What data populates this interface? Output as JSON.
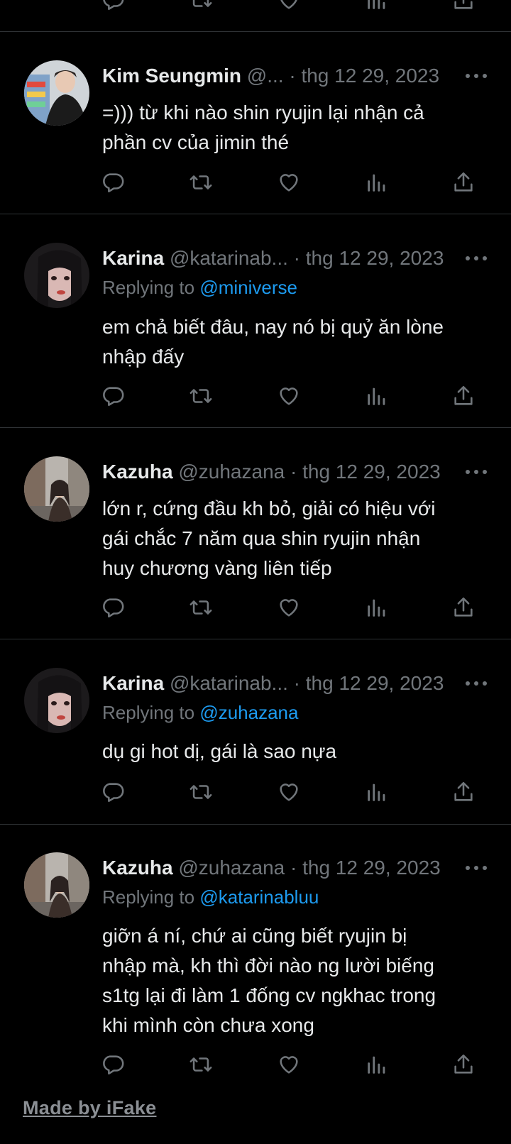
{
  "colors": {
    "background": "#000000",
    "text": "#e7e9ea",
    "muted": "#71767b",
    "link": "#1d9bf0",
    "divider": "#2f3336"
  },
  "icons": {
    "reply": "comment-bubble-icon",
    "retweet": "retweet-icon",
    "like": "heart-icon",
    "views": "bar-chart-icon",
    "share": "share-upload-icon",
    "more": "more-dots-icon"
  },
  "tweets": [
    {
      "name": "Kim Seungmin",
      "meta": "@... · thg 12 29, 2023",
      "replying_label": "",
      "replying_handle": "",
      "lines": [
        "=))) từ khi nào shin ryujin lại nhận cả",
        "phần cv của jimin thé"
      ]
    },
    {
      "name": "Karina",
      "meta": "@katarinab... · thg 12 29, 2023",
      "replying_label": "Replying to",
      "replying_handle": "@miniverse",
      "lines": [
        "em chả biết đâu, nay nó bị quỷ ăn lòne",
        "nhập đấy"
      ]
    },
    {
      "name": "Kazuha",
      "meta": "@zuhazana · thg 12 29, 2023",
      "replying_label": "",
      "replying_handle": "",
      "lines": [
        "lớn r, cứng đầu kh bỏ, giải có hiệu với",
        "gái chắc 7 năm qua shin ryujin nhận",
        "huy chương vàng liên tiếp"
      ]
    },
    {
      "name": "Karina",
      "meta": "@katarinab... · thg 12 29, 2023",
      "replying_label": "Replying to",
      "replying_handle": "@zuhazana",
      "lines": [
        "dụ gi hot dị, gái là sao nựa"
      ]
    },
    {
      "name": "Kazuha",
      "meta": "@zuhazana · thg 12 29, 2023",
      "replying_label": "Replying to",
      "replying_handle": "@katarinabluu",
      "lines": [
        "giỡn á ní, chứ ai cũng biết ryujin bị",
        "nhập mà, kh thì đời nào ng lười biếng",
        "s1tg lại đi làm 1 đống cv ngkhac trong",
        "khi mình còn chưa xong"
      ]
    }
  ],
  "watermark": "Made by iFake"
}
